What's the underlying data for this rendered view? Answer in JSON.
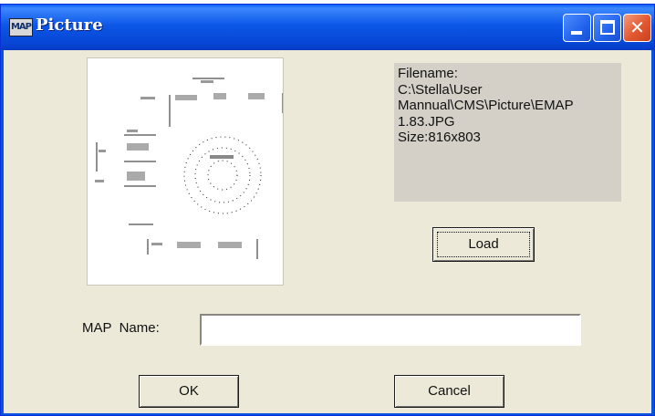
{
  "window": {
    "title": "Picture",
    "app_icon_text": "MAP",
    "icons": {
      "minimize": "minimize-icon",
      "maximize": "maximize-icon",
      "close": "close-icon"
    },
    "colors": {
      "titlebar": "#0a53e0",
      "client_bg": "#ece9d8",
      "info_panel_bg": "#d4d0c8",
      "close_button": "#e2572f"
    }
  },
  "file_info": {
    "lines": [
      "Filename:",
      "C:\\Stella\\User",
      "Mannual\\CMS\\Picture\\EMAP",
      "1.83.JPG",
      "Size:816x803"
    ]
  },
  "buttons": {
    "load": "Load",
    "ok": "OK",
    "cancel": "Cancel"
  },
  "map_name": {
    "label": "MAP  Name:",
    "value": ""
  }
}
